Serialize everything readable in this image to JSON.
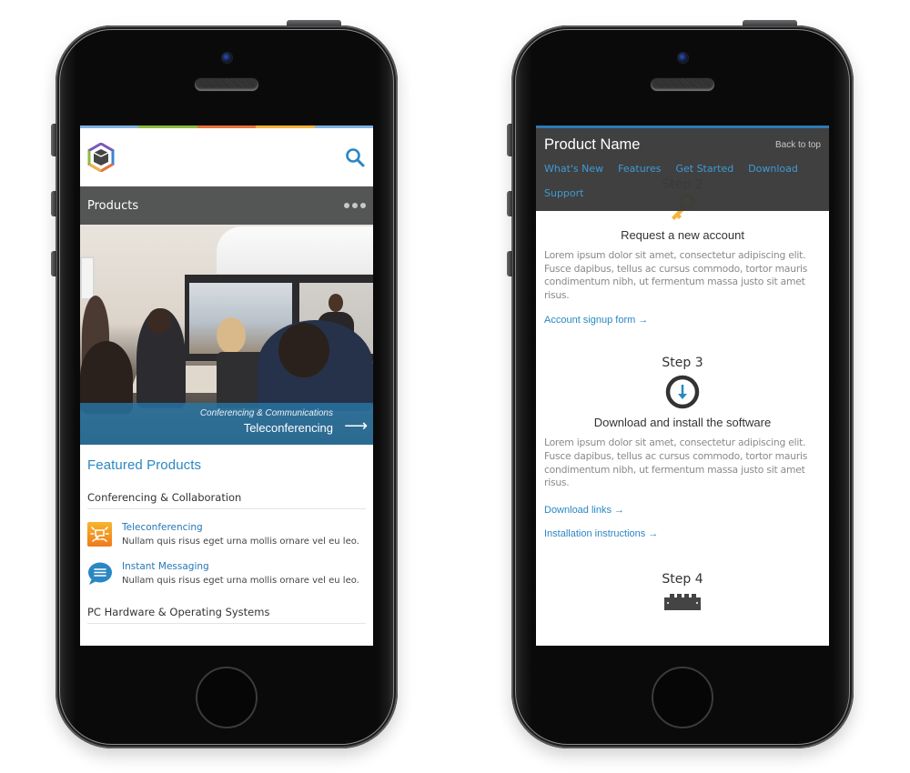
{
  "left_phone": {
    "brand_colors": [
      "#7fb3e2",
      "#8dbb3f",
      "#e8743a",
      "#f4b23a",
      "#7fb3e2"
    ],
    "header": {
      "logo_icon": "hexagon-cube-logo",
      "search_icon": "magnifier-icon",
      "accent": "#2b87c3"
    },
    "nav": {
      "title": "Products",
      "more_icon": "more-dots-icon"
    },
    "hero": {
      "image_alt": "Video conference meeting room",
      "category": "Conferencing & Communications",
      "title": "Teleconferencing",
      "arrow_icon": "arrow-right-icon"
    },
    "featured": {
      "heading": "Featured Products",
      "categories": [
        {
          "name": "Conferencing & Collaboration",
          "items": [
            {
              "title": "Teleconferencing",
              "description": "Nullam quis risus eget urna mollis ornare vel eu leo.",
              "icon": "teleconference-icon",
              "icon_color": "#f28a1e"
            },
            {
              "title": "Instant Messaging",
              "description": "Nullam quis risus eget urna mollis ornare vel eu leo.",
              "icon": "chat-bubble-icon",
              "icon_color": "#2b87c3"
            }
          ]
        },
        {
          "name": "PC Hardware & Operating Systems",
          "items": []
        }
      ]
    }
  },
  "right_phone": {
    "header": {
      "product_name": "Product Name",
      "back_to_top": "Back to top",
      "nav": [
        "What's New",
        "Features",
        "Get Started",
        "Download",
        "Support"
      ]
    },
    "steps": [
      {
        "label": "Step 2",
        "icon": "key-icon",
        "title": "Request a new account",
        "body": "Lorem ipsum dolor sit amet, consectetur adipiscing elit. Fusce dapibus, tellus ac cursus commodo, tortor mauris condimentum nibh, ut fermentum massa justo sit amet risus.",
        "links": [
          "Account signup form →"
        ]
      },
      {
        "label": "Step 3",
        "icon": "download-circle-icon",
        "title": "Download and install the software",
        "body": "Lorem ipsum dolor sit amet, consectetur adipiscing elit. Fusce dapibus, tellus ac cursus commodo, tortor mauris condimentum nibh, ut fermentum massa justo sit amet risus.",
        "links": [
          "Download links →",
          "Installation instructions →"
        ]
      },
      {
        "label": "Step 4",
        "icon": "chip-icon"
      }
    ],
    "colors": {
      "key": "#f5b43a",
      "link": "#2b87c3",
      "header_bg": "#3a3a3a",
      "header_accent": "#2b7bb5"
    }
  }
}
